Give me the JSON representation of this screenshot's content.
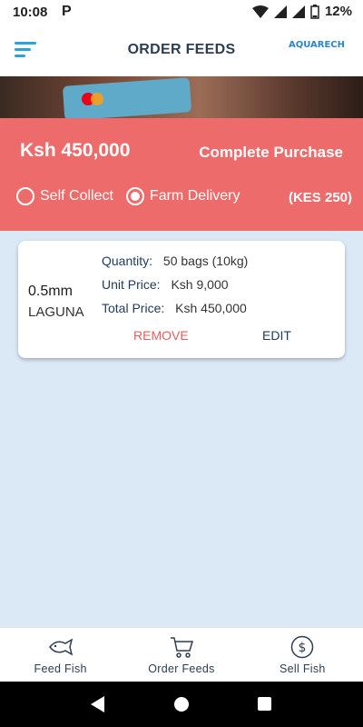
{
  "status_bar": {
    "time": "10:08",
    "app_icon": "P",
    "battery": "12%"
  },
  "header": {
    "title": "ORDER FEEDS",
    "logo_text": "AQUARECH"
  },
  "summary": {
    "amount": "Ksh 450,000",
    "action_label": "Complete Purchase",
    "options": [
      {
        "label": "Self Collect",
        "selected": false
      },
      {
        "label": "Farm Delivery",
        "selected": true
      }
    ],
    "delivery_fee": "(KES 250)"
  },
  "order": {
    "size": "0.5mm",
    "brand": "LAGUNA",
    "quantity_label": "Quantity:",
    "quantity_value": "50 bags (10kg)",
    "unit_price_label": "Unit Price:",
    "unit_price_value": "Ksh 9,000",
    "total_price_label": "Total Price:",
    "total_price_value": "Ksh 450,000",
    "remove_label": "REMOVE",
    "edit_label": "EDIT"
  },
  "bottom_nav": [
    {
      "label": "Feed Fish",
      "icon": "fish-icon"
    },
    {
      "label": "Order Feeds",
      "icon": "cart-icon"
    },
    {
      "label": "Sell Fish",
      "icon": "dollar-icon"
    }
  ],
  "colors": {
    "accent": "#ed6c6b",
    "primary_text": "#1f3b57",
    "background": "#dbe9f6",
    "remove": "#e06060"
  }
}
